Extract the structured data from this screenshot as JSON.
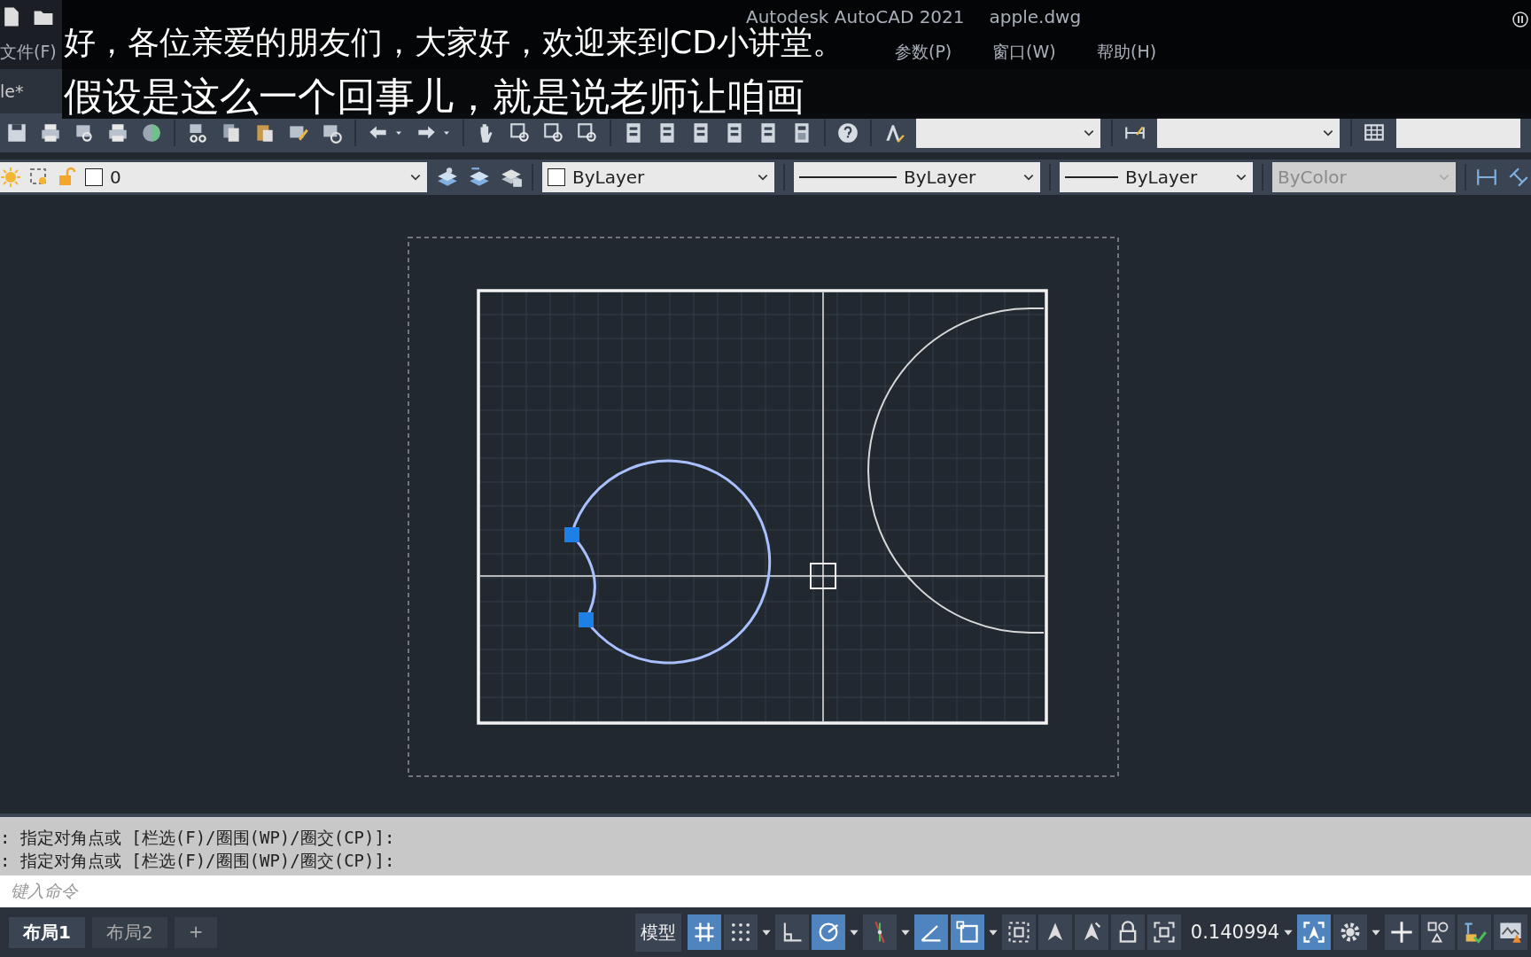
{
  "window": {
    "title": "Autodesk AutoCAD 2021",
    "file_name": "apple.dwg"
  },
  "menu": [
    {
      "label": "文件(F)"
    },
    {
      "label": "参数(P)"
    },
    {
      "label": "窗口(W)"
    },
    {
      "label": "帮助(H)"
    }
  ],
  "file_tab": {
    "label": "le*"
  },
  "subtitles": [
    "好，各位亲爱的朋友们，大家好，欢迎来到CD小讲堂。",
    "假设是这么一个回事儿，就是说老师让咱画"
  ],
  "properties": {
    "layer": "0",
    "color_setting": "ByLayer",
    "linetype": "ByLayer",
    "lineweight": "ByLayer",
    "plot_style": {
      "value": "ByColor",
      "disabled": true
    }
  },
  "command_history": [
    ": 指定对角点或 [栏选(F)/圈围(WP)/圈交(CP)]:",
    ": 指定对角点或 [栏选(F)/圈围(WP)/圈交(CP)]:"
  ],
  "command_input": {
    "placeholder": "键入命令"
  },
  "layout_tabs": [
    {
      "label": "布局1",
      "selected": true
    },
    {
      "label": "布局2",
      "selected": false
    },
    {
      "label": "+",
      "selected": false
    }
  ],
  "status_bar": {
    "space": "模型",
    "scale": "0.140994",
    "toggles": [
      {
        "kind": "grid",
        "on": true
      },
      {
        "kind": "snap",
        "on": false,
        "dropdown": true
      },
      {
        "kind": "ortho",
        "on": false
      },
      {
        "kind": "polar",
        "on": true,
        "dropdown": true
      },
      {
        "kind": "tracking",
        "on": false,
        "dropdown": true
      },
      {
        "kind": "angle",
        "on": true
      },
      {
        "kind": "osnap",
        "on": true,
        "dropdown": true
      },
      {
        "kind": "selection",
        "on": false
      },
      {
        "kind": "annotation",
        "on": false
      },
      {
        "kind": "autoscale",
        "on": false
      },
      {
        "kind": "lock",
        "on": false
      },
      {
        "kind": "maximize",
        "on": false
      }
    ],
    "tail": [
      {
        "kind": "viewport",
        "on": true
      },
      {
        "kind": "gear",
        "on": false,
        "dropdown": true
      },
      {
        "kind": "plus",
        "on": false
      },
      {
        "kind": "isolate",
        "on": false
      },
      {
        "kind": "units",
        "on": false
      },
      {
        "kind": "monitor",
        "on": false
      }
    ]
  }
}
